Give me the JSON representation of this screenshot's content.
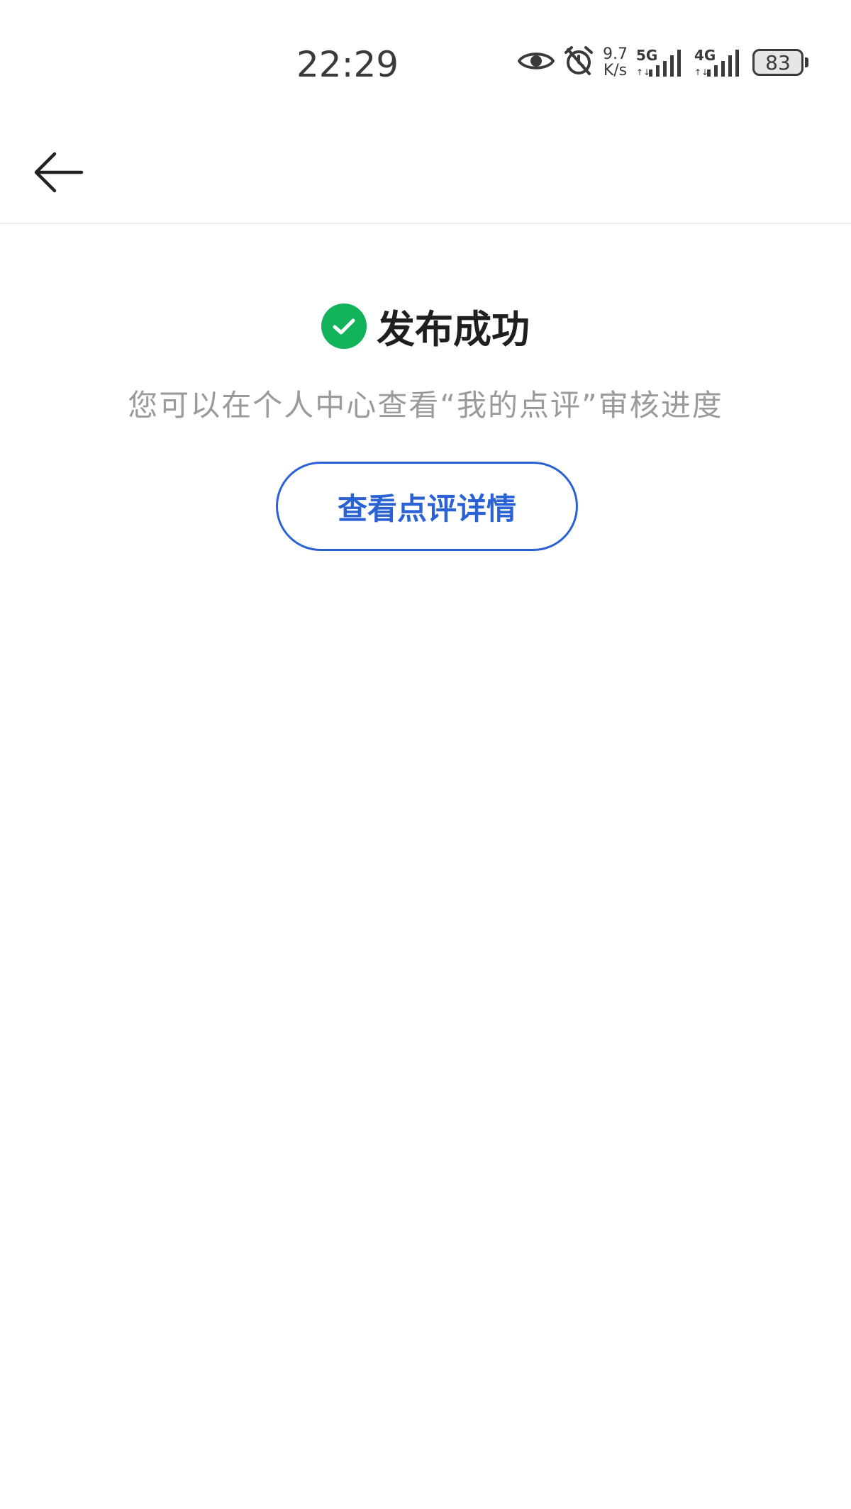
{
  "status_bar": {
    "time": "22:29",
    "net_speed_value": "9.7",
    "net_speed_unit": "K/s",
    "network_1": "5G",
    "network_2": "4G",
    "battery": "83",
    "icons": [
      "eye-icon",
      "alarm-icon",
      "signal-5g-icon",
      "signal-4g-icon",
      "battery-icon"
    ]
  },
  "nav": {
    "back_icon": "arrow-left-icon"
  },
  "result": {
    "icon": "check-circle-icon",
    "icon_color": "#12b35b",
    "title": "发布成功",
    "hint": "您可以在个人中心查看“我的点评”审核进度",
    "button_label": "查看点评详情",
    "button_color": "#2a62d6"
  }
}
